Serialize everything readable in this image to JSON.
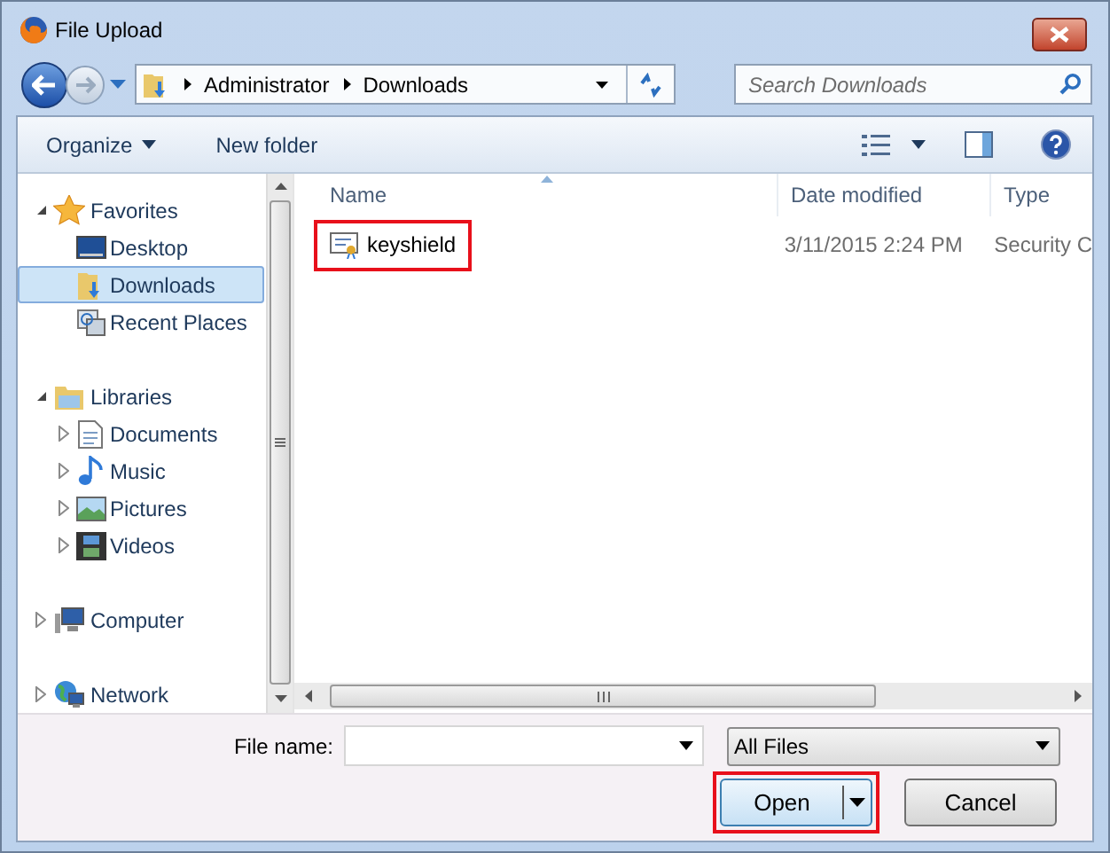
{
  "window": {
    "title": "File Upload"
  },
  "address_bar": {
    "path": [
      "Administrator",
      "Downloads"
    ]
  },
  "search": {
    "placeholder": "Search Downloads"
  },
  "toolbar": {
    "buttons": [
      {
        "label": "Organize",
        "dropdown": true
      },
      {
        "label": "New folder",
        "dropdown": false
      }
    ]
  },
  "nav_pane": {
    "groups": [
      {
        "label": "Favorites",
        "expanded": true,
        "children": [
          {
            "label": "Desktop",
            "selected": false
          },
          {
            "label": "Downloads",
            "selected": true
          },
          {
            "label": "Recent Places",
            "selected": false
          }
        ]
      },
      {
        "label": "Libraries",
        "expanded": true,
        "children": [
          {
            "label": "Documents",
            "selected": false,
            "expanded": false
          },
          {
            "label": "Music",
            "selected": false,
            "expanded": false
          },
          {
            "label": "Pictures",
            "selected": false,
            "expanded": false
          },
          {
            "label": "Videos",
            "selected": false,
            "expanded": false
          }
        ]
      },
      {
        "label": "Computer",
        "expanded": false
      },
      {
        "label": "Network",
        "expanded": false
      }
    ]
  },
  "file_list": {
    "columns": [
      {
        "label": "Name",
        "sorted": true
      },
      {
        "label": "Date modified",
        "sorted": false
      },
      {
        "label": "Type",
        "sorted": false
      }
    ],
    "rows": [
      {
        "cells": [
          "keyshield",
          "3/11/2015 2:24 PM",
          "Security C"
        ],
        "highlighted": true
      }
    ]
  },
  "file_name": {
    "label": "File name:"
  },
  "file_type": {
    "value": "All Files"
  },
  "buttons": [
    {
      "label": "Open",
      "kind": "split",
      "highlighted": true
    },
    {
      "label": "Cancel",
      "kind": "plain",
      "highlighted": false
    }
  ]
}
